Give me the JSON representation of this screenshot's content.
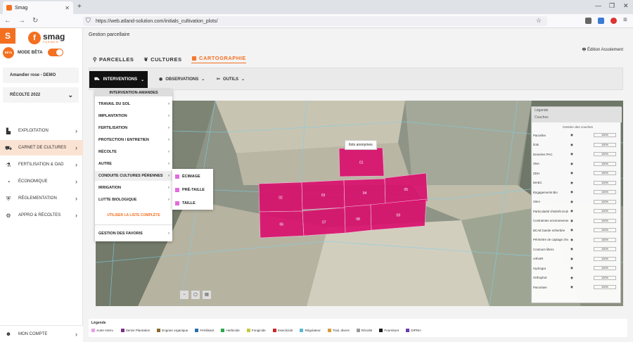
{
  "browser": {
    "tab_title": "Smag",
    "new_tab": "+",
    "url": "https://web.atland-solution.com/initials_cultivation_plots/",
    "minimize": "—",
    "maximize": "❐",
    "close": "✕"
  },
  "sidebar": {
    "logo_letter": "S",
    "brand": "smag",
    "brand_sub": "FARMER",
    "beta_badge": "BÊTA",
    "beta_label": "MODE BÊTA",
    "farm": "Amandier rose - DEMO",
    "harvest": "RÉCOLTE 2022",
    "items": [
      {
        "label": "EXPLOITATION"
      },
      {
        "label": "CARNET DE CULTURES"
      },
      {
        "label": "FERTILISATION & OAD"
      },
      {
        "label": "ÉCONOMIQUE"
      },
      {
        "label": "RÉGLEMENTATION"
      },
      {
        "label": "APPRO & RÉCOLTES"
      }
    ],
    "account": "MON COMPTE"
  },
  "main": {
    "title": "Gestion parcellaire",
    "print": "Édition Assolement",
    "tabs": [
      "PARCELLES",
      "CULTURES",
      "CARTOGRAPHIE"
    ],
    "toolbar": {
      "interventions": "INTERVENTIONS",
      "observations": "OBSERVATIONS",
      "outils": "OUTILS"
    },
    "tooltip": "Ilots anonymes"
  },
  "dropdown": {
    "header": "INTERVENTION-AMANDES",
    "items": [
      "TRAVAIL DU SOL",
      "IMPLANTATION",
      "FERTILISATION",
      "PROTECTION / ENTRETIEN",
      "RÉCOLTE",
      "AUTRE",
      "CONDUITE CULTURES PÉRENNES",
      "IRRIGATION",
      "LUTTE BIOLOGIQUE"
    ],
    "link": "UTILISER LA LISTE COMPLÈTE",
    "favorites": "GESTION DES FAVORIS",
    "submenu": [
      "ÉCIMAGE",
      "PRÉ-TAILLE",
      "TAILLE"
    ]
  },
  "layers": {
    "title": "Légende",
    "tab": "Couches",
    "manage": "Gestion des couches",
    "pct": "100%",
    "rows": [
      "Parcelles",
      "Ilots",
      "Données PAC",
      "SNA",
      "ZDH",
      "MAEC",
      "Engagements Bio",
      "Sites",
      "Particularité d'intérêt écologique",
      "Contraintes environnementales",
      "BCAE bande enherbée",
      "Périmètre de captage d'eau potable",
      "Contours libres",
      "orthoIR",
      "Hydrogra",
      "Orthophot",
      "Parcelaire"
    ]
  },
  "legend": {
    "title": "Légende",
    "items": [
      {
        "label": "Autre Interv.",
        "color": "#e8a0e6"
      },
      {
        "label": "Semis Plantation",
        "color": "#7b2f8c"
      },
      {
        "label": "Engrais organique",
        "color": "#8a6a2a"
      },
      {
        "label": "Fertilisant",
        "color": "#2a6fb0"
      },
      {
        "label": "Herbicide",
        "color": "#2aa84a"
      },
      {
        "label": "Fongicide",
        "color": "#c8c83a"
      },
      {
        "label": "Insecticide",
        "color": "#c8282a"
      },
      {
        "label": "Régulateur",
        "color": "#58b8d8"
      },
      {
        "label": "Trait. divers",
        "color": "#d89a3a"
      },
      {
        "label": "Récolte",
        "color": "#9a9a9a"
      },
      {
        "label": "Fourniture",
        "color": "#1a1a1a"
      },
      {
        "label": "DIPNH",
        "color": "#6a3aa8"
      }
    ]
  },
  "map": {
    "parcels": [
      "01",
      "02",
      "03",
      "04",
      "05",
      "06",
      "07",
      "08",
      "09",
      "10"
    ]
  }
}
